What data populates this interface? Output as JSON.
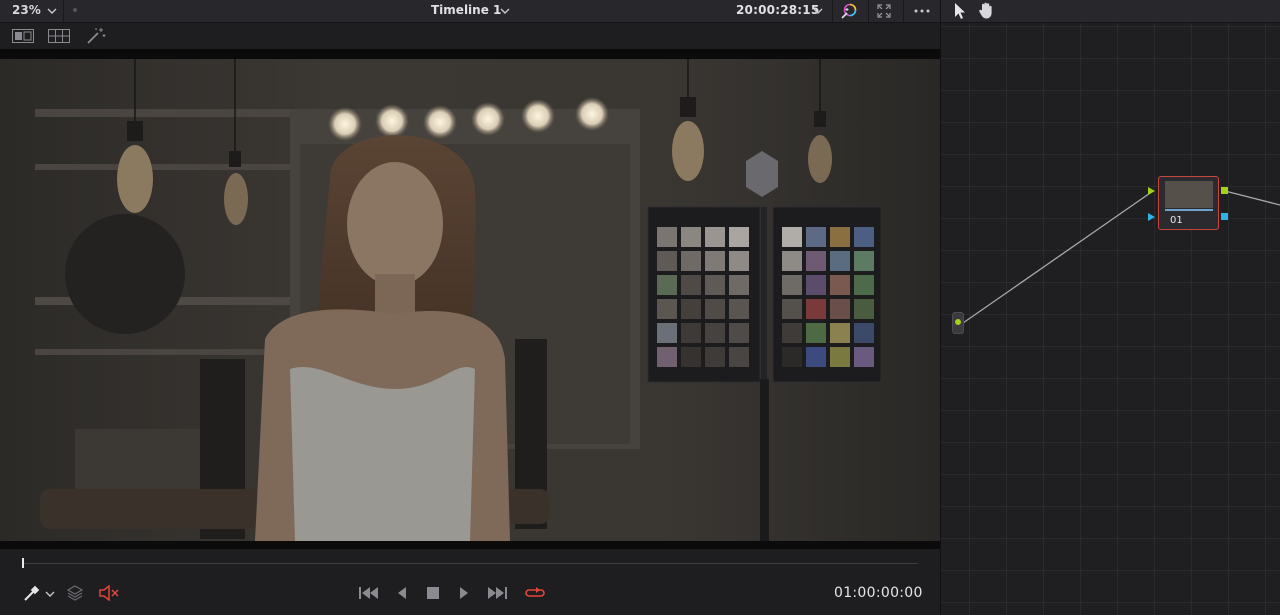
{
  "viewer": {
    "zoom": "23%",
    "timeline_title": "Timeline 1",
    "timecode": "20:00:28:15"
  },
  "transport": {
    "timecode": "01:00:00:00"
  },
  "node_editor": {
    "node_label": "01"
  },
  "icons": {
    "zoom_dropdown": "chevron-down-icon",
    "timeline_dropdown": "chevron-down-icon",
    "timecode_dropdown": "chevron-down-icon",
    "color_effects": "color-wand-icon",
    "fullscreen": "expand-icon",
    "options": "more-horizontal-icon",
    "pointer": "pointer-icon",
    "hand": "hand-icon",
    "split_view": "split-screen-icon",
    "grid_view": "grid-icon",
    "highlight": "magic-wand-icon",
    "picker": "eyedropper-icon",
    "layers": "layers-icon",
    "mute": "mute-icon",
    "first_frame": "skip-back-icon",
    "reverse_play": "play-reverse-icon",
    "stop": "stop-icon",
    "play": "play-icon",
    "last_frame": "skip-forward-icon",
    "loop": "loop-icon"
  },
  "colors": {
    "accent_red": "#e2453a",
    "node_border": "#c8473d",
    "rgb_input": "#a4d11b",
    "key_input": "#2fb3e6"
  }
}
